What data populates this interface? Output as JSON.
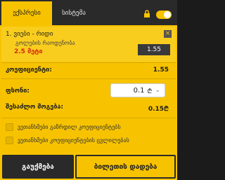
{
  "tabs": {
    "active": "ექსპრესი",
    "inactive": "სისტემა"
  },
  "icons": {
    "lock": "lock-icon",
    "toggle": "toggle-switch"
  },
  "bet": {
    "index": "1.",
    "match": "ვიები - რიდი",
    "market": "გოლების რაოდენობა",
    "line": "2.5 მეტი",
    "odds": "1.55",
    "close": "×"
  },
  "summary": {
    "coef_label": "კოეფიციენტი:",
    "coef_value": "1.55",
    "stake_label": "ფსონი:",
    "stake_value": "0.1",
    "win_label": "შესაძლო მოგება:",
    "win_value": "0.15"
  },
  "options": [
    "ვეთანხმები გაზრდილ კოეფიციენტებს",
    "ვეთანხმები კოეფიციენტების ცვლილებას"
  ],
  "buttons": {
    "clear": "გაუქმება",
    "place": "ბილეთის დადება"
  },
  "colors": {
    "accent": "#f7c300",
    "dark": "#2a2a2a",
    "line_red": "#d22b12"
  }
}
